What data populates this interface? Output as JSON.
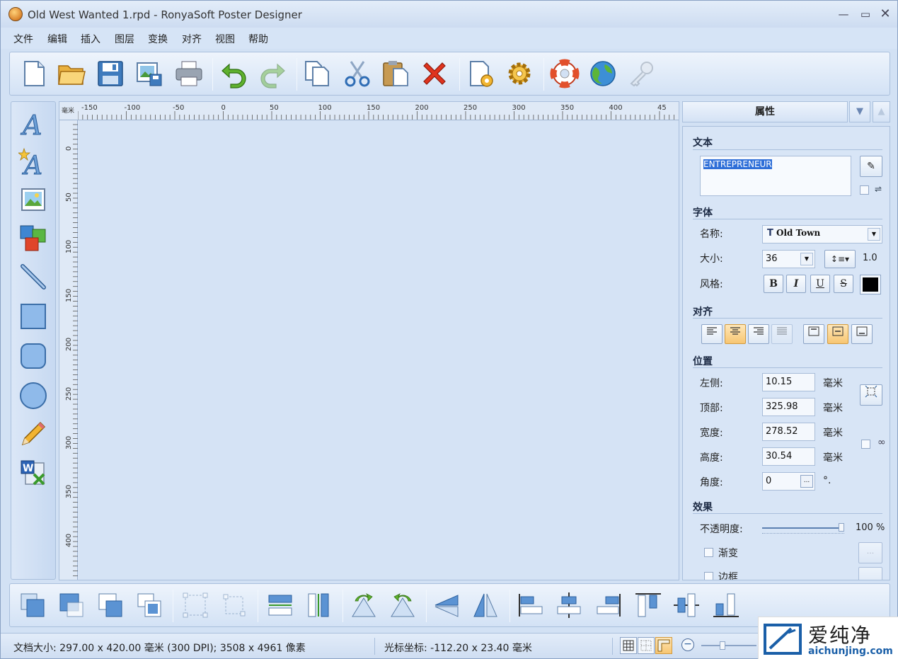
{
  "window": {
    "title": "Old West Wanted 1.rpd - RonyaSoft Poster Designer"
  },
  "menu": [
    "文件",
    "编辑",
    "插入",
    "图层",
    "变换",
    "对齐",
    "视图",
    "帮助"
  ],
  "toolbar_icons": [
    "new-document",
    "open-folder",
    "save",
    "save-as-image",
    "print",
    "undo",
    "redo",
    "copy",
    "cut",
    "paste",
    "delete",
    "page-setup",
    "settings-gear",
    "help-lifebuoy",
    "web-globe",
    "license-key"
  ],
  "left_tools": [
    "text-tool",
    "art-text-tool",
    "image-tool",
    "clipart-tool",
    "line-tool",
    "rectangle-tool",
    "rounded-rectangle-tool",
    "ellipse-tool",
    "pencil-tool",
    "word-import-tool"
  ],
  "ruler": {
    "unit": "毫米",
    "h_ticks": [
      "-150",
      "-100",
      "-50",
      "0",
      "50",
      "100",
      "150",
      "200",
      "250",
      "300",
      "350",
      "400",
      "45"
    ],
    "v_ticks": [
      "0",
      "50",
      "100",
      "150",
      "200",
      "250",
      "300",
      "350",
      "400"
    ]
  },
  "panel": {
    "header": "属性",
    "text_section": "文本",
    "text_value": "ENTREPRENEUR",
    "font_section": "字体",
    "name_label": "名称:",
    "font_name": "Old Town",
    "size_label": "大小:",
    "font_size": "36",
    "line_spacing": "1.0",
    "style_label": "风格:",
    "style_buttons": [
      "B",
      "I",
      "U",
      "S"
    ],
    "text_color": "#000000",
    "align_section": "对齐",
    "position_section": "位置",
    "left_label": "左侧:",
    "left_value": "10.15",
    "top_label": "顶部:",
    "top_value": "325.98",
    "width_label": "宽度:",
    "width_value": "278.52",
    "height_label": "高度:",
    "height_value": "30.54",
    "angle_label": "角度:",
    "angle_value": "0",
    "angle_unit": "°.",
    "unit": "毫米",
    "effects_section": "效果",
    "opacity_label": "不透明度:",
    "opacity_value": "100 %",
    "opacity": 1.0,
    "gradient_label": "渐变",
    "border_label": "边框",
    "more_button": "..."
  },
  "bottom_tools": [
    "bring-to-front",
    "bring-forward",
    "send-backward",
    "send-to-back",
    "group",
    "ungroup",
    "center-horizontal",
    "center-vertical",
    "rotate-left",
    "rotate-right",
    "flip-vertical",
    "flip-horizontal",
    "align-left",
    "align-center",
    "align-right",
    "align-top",
    "align-middle",
    "align-bottom"
  ],
  "status": {
    "doc_size": "文档大小: 297.00 x 420.00 毫米 (300 DPI); 3508 x 4961 像素",
    "cursor": "光标坐标: -112.20 x 23.40 毫米"
  },
  "watermark": {
    "brand": "爱纯净",
    "url": "aichunjing.com"
  }
}
